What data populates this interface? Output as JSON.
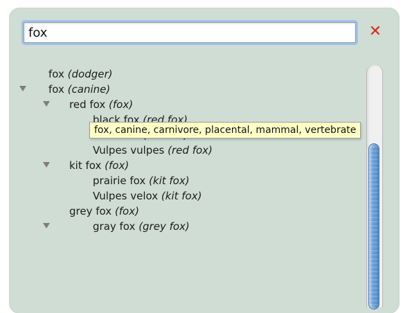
{
  "search": {
    "value": "fox",
    "clear_icon": "close-icon",
    "clear_color": "#d32a1e"
  },
  "tree": {
    "rows": [
      {
        "word": "fox",
        "parent": "(dodger)",
        "expanded": null
      },
      {
        "word": "fox",
        "parent": "(canine)",
        "expanded": true
      },
      {
        "word": "red fox",
        "parent": "(fox)",
        "expanded": true
      },
      {
        "word": "black fox",
        "parent": "(red fox)",
        "expanded": null
      },
      {
        "word": "silver fox",
        "parent": "(red fox)",
        "expanded": null
      },
      {
        "word": "Vulpes vulpes",
        "parent": "(red fox)",
        "expanded": null
      },
      {
        "word": "kit fox",
        "parent": "(fox)",
        "expanded": true
      },
      {
        "word": "prairie fox",
        "parent": "(kit fox)",
        "expanded": null
      },
      {
        "word": "Vulpes velox",
        "parent": "(kit fox)",
        "expanded": null
      },
      {
        "word": "grey fox",
        "parent": "(fox)",
        "expanded": true
      },
      {
        "word": "gray fox",
        "parent": "(grey fox)",
        "expanded": null
      }
    ]
  },
  "tooltip": {
    "text": "fox, canine, carnivore, placental, mammal, vertebrate"
  },
  "colors": {
    "panel_background": "#cfddd4",
    "tooltip_background": "#ffffc6",
    "scroll_thumb": "#5b93cd"
  }
}
